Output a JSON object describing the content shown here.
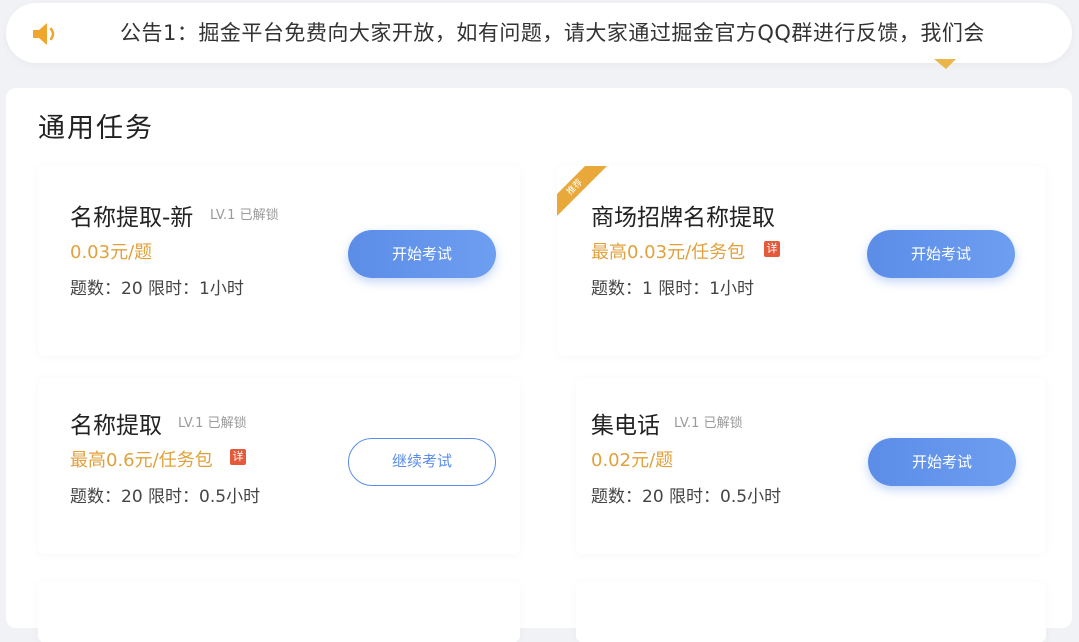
{
  "notice": {
    "icon": "speaker-icon",
    "text": "公告1：掘金平台免费向大家开放，如有问题，请大家通过掘金官方QQ群进行反馈，我们会"
  },
  "section": {
    "title": "通用任务"
  },
  "tasks": [
    {
      "name": "名称提取-新",
      "level": "LV.1 已解锁",
      "price": "0.03元/题",
      "detail": "",
      "meta": "题数：20 限时：1小时",
      "button": "开始考试",
      "button_style": "primary",
      "ribbon": ""
    },
    {
      "name": "商场招牌名称提取",
      "level": "",
      "price": "最高0.03元/任务包",
      "detail": "详",
      "meta": "题数：1 限时：1小时",
      "button": "开始考试",
      "button_style": "primary",
      "ribbon": "推荐"
    },
    {
      "name": "名称提取",
      "level": "LV.1 已解锁",
      "price": "最高0.6元/任务包",
      "detail": "详",
      "meta": "题数：20 限时：0.5小时",
      "button": "继续考试",
      "button_style": "outline",
      "ribbon": ""
    },
    {
      "name": "集电话",
      "level": "LV.1 已解锁",
      "price": "0.02元/题",
      "detail": "",
      "meta": "题数：20 限时：0.5小时",
      "button": "开始考试",
      "button_style": "primary",
      "ribbon": ""
    }
  ],
  "colors": {
    "accent": "#5b8de8",
    "price": "#e1a13c",
    "ribbon": "#e8a93a",
    "detail_badge": "#e45a3a"
  }
}
